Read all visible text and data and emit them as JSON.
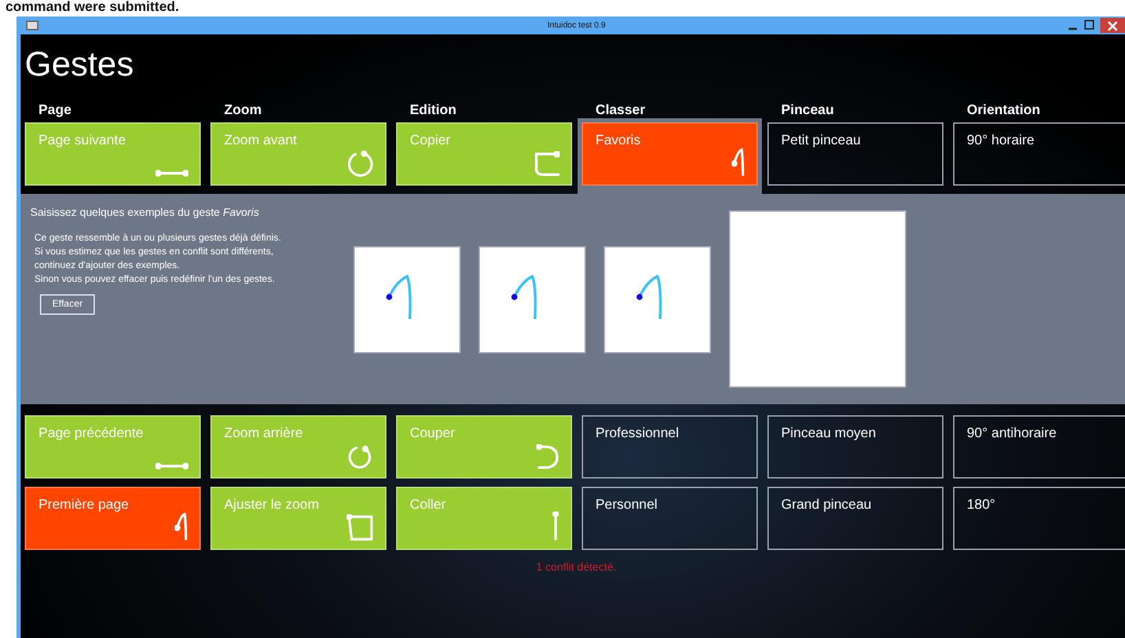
{
  "caption": "command were submitted.",
  "window": {
    "title": "Intuidoc test 0.9"
  },
  "heading": "Gestes",
  "columns": [
    {
      "header": "Page",
      "items": [
        {
          "label": "Page suivante",
          "kind": "line",
          "conflict": false,
          "selected": false
        },
        {
          "label": "Page précédente",
          "kind": "line",
          "conflict": false,
          "selected": false
        },
        {
          "label": "Première page",
          "kind": "hook",
          "conflict": true,
          "selected": false
        }
      ]
    },
    {
      "header": "Zoom",
      "items": [
        {
          "label": "Zoom avant",
          "kind": "circle",
          "conflict": false,
          "selected": false
        },
        {
          "label": "Zoom arrière",
          "kind": "circle",
          "conflict": false,
          "selected": false
        },
        {
          "label": "Ajuster le zoom",
          "kind": "square",
          "conflict": false,
          "selected": false
        }
      ]
    },
    {
      "header": "Edition",
      "items": [
        {
          "label": "Copier",
          "kind": "corner",
          "conflict": false,
          "selected": false
        },
        {
          "label": "Couper",
          "kind": "uturn",
          "conflict": false,
          "selected": false
        },
        {
          "label": "Coller",
          "kind": "vline",
          "conflict": false,
          "selected": false
        }
      ]
    },
    {
      "header": "Classer",
      "items": [
        {
          "label": "Favoris",
          "kind": "hook",
          "conflict": false,
          "selected": true
        },
        {
          "label": "Professionnel",
          "kind": "blank",
          "conflict": false,
          "selected": false
        },
        {
          "label": "Personnel",
          "kind": "blank",
          "conflict": false,
          "selected": false
        }
      ]
    },
    {
      "header": "Pinceau",
      "items": [
        {
          "label": "Petit pinceau",
          "kind": "blank",
          "conflict": false,
          "selected": false
        },
        {
          "label": "Pinceau moyen",
          "kind": "blank",
          "conflict": false,
          "selected": false
        },
        {
          "label": "Grand pinceau",
          "kind": "blank",
          "conflict": false,
          "selected": false
        }
      ]
    },
    {
      "header": "Orientation",
      "items": [
        {
          "label": "90° horaire",
          "kind": "blank",
          "conflict": false,
          "selected": false
        },
        {
          "label": "90° antihoraire",
          "kind": "blank",
          "conflict": false,
          "selected": false
        },
        {
          "label": "180°",
          "kind": "blank",
          "conflict": false,
          "selected": false
        }
      ]
    }
  ],
  "panel": {
    "title": "Saisissez quelques exemples du geste *Favoris*",
    "message": "Ce geste ressemble à un ou plusieurs gestes déjà définis.\nSi vous estimez que les gestes en conflit sont différents,\ncontinuez d'ajouter des exemples.\nSinon vous pouvez effacer puis redéfinir l'un des gestes.",
    "button": "Effacer",
    "samples": [
      {
        "kind": "drawn"
      },
      {
        "kind": "drawn"
      },
      {
        "kind": "drawn"
      },
      {
        "kind": "pad"
      }
    ]
  },
  "status": "1 conflit détecté."
}
